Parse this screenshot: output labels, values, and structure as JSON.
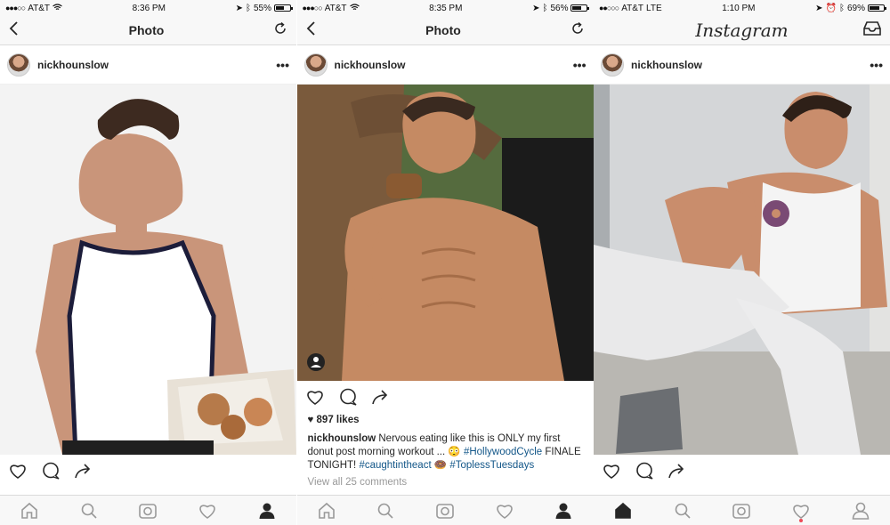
{
  "screens": [
    {
      "status": {
        "carrier": "AT&T",
        "time": "8:36 PM",
        "battery": "55%",
        "battery_fill": 0.55
      },
      "nav": {
        "title": "Photo"
      },
      "post": {
        "username": "nickhounslow",
        "more": "•••"
      }
    },
    {
      "status": {
        "carrier": "AT&T",
        "time": "8:35 PM",
        "battery": "56%",
        "battery_fill": 0.56
      },
      "nav": {
        "title": "Photo"
      },
      "post": {
        "username": "nickhounslow",
        "more": "•••",
        "likes": "897 likes",
        "caption_user": "nickhounslow",
        "caption_text": "Nervous eating like this is ONLY my first donut post morning workout ...",
        "hashtag1": "#HollywoodCycle",
        "caption_text2": "FINALE TONIGHT!",
        "hashtag2": "#caughtintheact",
        "hashtag3": "#ToplessTuesdays",
        "comments": "View all 25 comments"
      }
    },
    {
      "status": {
        "carrier": "AT&T",
        "network": "LTE",
        "time": "1:10 PM",
        "battery": "69%",
        "battery_fill": 0.69
      },
      "nav": {
        "title": "Instagram"
      },
      "post": {
        "username": "nickhounslow",
        "more": "•••"
      }
    }
  ],
  "icons": {
    "back": "back-chevron-icon",
    "refresh": "refresh-icon",
    "inbox": "inbox-icon",
    "like": "heart-icon",
    "comment": "comment-icon",
    "share": "share-icon",
    "home": "home-icon",
    "search": "search-icon",
    "camera": "camera-icon",
    "activity": "activity-heart-icon",
    "profile": "profile-icon"
  },
  "colors": {
    "hashtag": "#125688",
    "notification": "#ed4956"
  }
}
